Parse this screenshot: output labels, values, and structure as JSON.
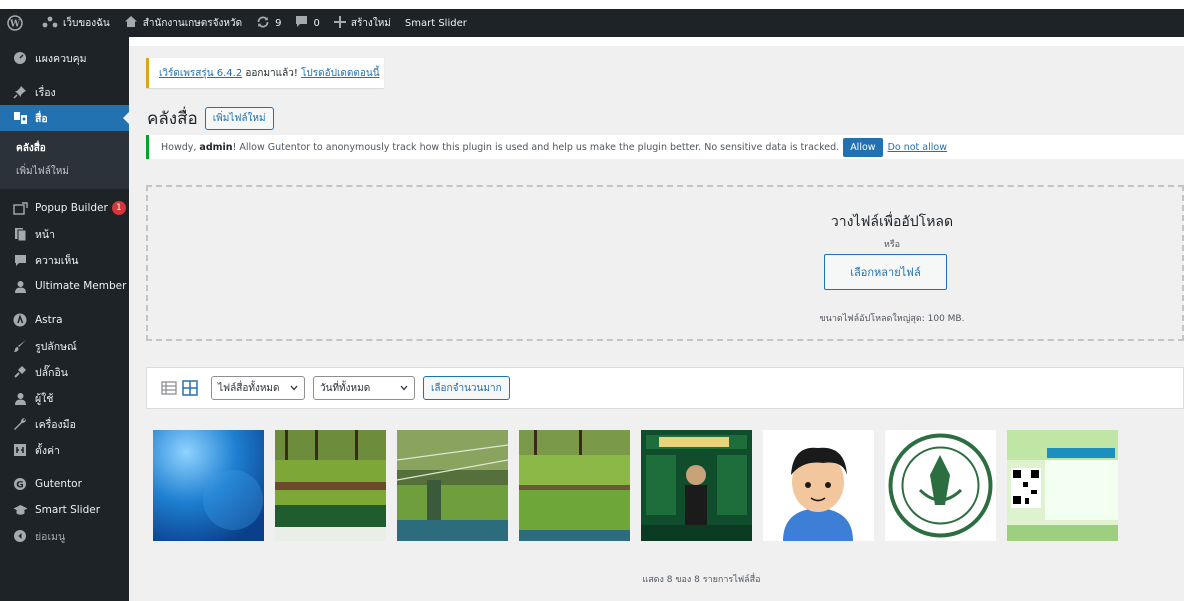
{
  "adminbar": {
    "site_name": "เว็บของฉัน",
    "office_name": "สำนักงานเกษตรจังหวัด",
    "updates_count": "9",
    "comments_count": "0",
    "new_label": "สร้างใหม่",
    "smart_slider": "Smart Slider"
  },
  "sidebar": {
    "dashboard": "แผงควบคุม",
    "posts": "เรื่อง",
    "media": "สื่อ",
    "sub_library": "คลังสื่อ",
    "sub_add_new": "เพิ่มไฟล์ใหม่",
    "popup_builder": "Popup Builder",
    "popup_badge": "1",
    "pages": "หน้า",
    "comments": "ความเห็น",
    "ultimate_member": "Ultimate Member",
    "astra": "Astra",
    "appearance": "รูปลักษณ์",
    "plugins": "ปลั๊กอิน",
    "users": "ผู้ใช้",
    "tools": "เครื่องมือ",
    "settings": "ตั้งค่า",
    "gutentor": "Gutentor",
    "smart_slider": "Smart Slider",
    "collapse": "ย่อเมนู"
  },
  "notice_update": {
    "link_text": "เวิร์ดเพรสรุ่น 6.4.2",
    "middle_text": " ออกมาแล้ว! ",
    "update_link": "โปรดอัปเดตตอนนี้"
  },
  "page": {
    "title": "คลังสื่อ",
    "add_new_button": "เพิ่มไฟล์ใหม่"
  },
  "gutentor_notice": {
    "prefix": "Howdy, ",
    "user": "admin",
    "message": "! Allow Gutentor to anonymously track how this plugin is used and help us make the plugin better. No sensitive data is tracked.",
    "allow": "Allow",
    "deny": "Do not allow"
  },
  "upload": {
    "title": "วางไฟล์เพื่ออัปโหลด",
    "or": "หรือ",
    "select_button": "เลือกหลายไฟล์",
    "max_size": "ขนาดไฟล์อัปโหลดใหญ่สุด: 100 MB."
  },
  "toolbar": {
    "filter_type": "ไฟล์สื่อทั้งหมด",
    "filter_date": "วันที่ทั้งหมด",
    "bulk_select": "เลือกจำนวนมาก"
  },
  "footer": {
    "count_text": "แสดง 8 ของ 8 รายการไฟล์สื่อ"
  },
  "colors": {
    "admin_dark": "#1d2327",
    "accent": "#2271b1",
    "warning": "#dba617",
    "success": "#00a32a"
  }
}
